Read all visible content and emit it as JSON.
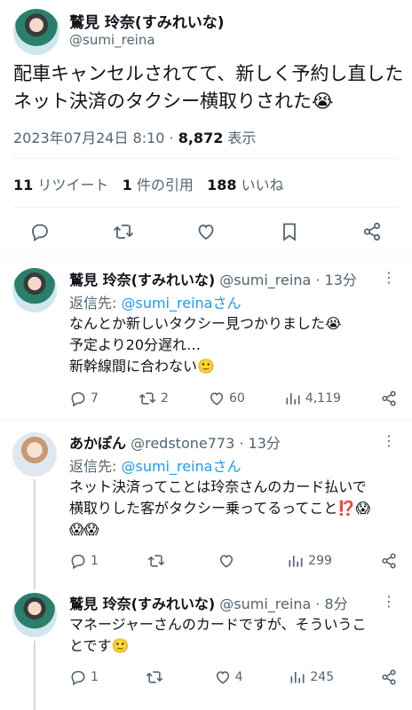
{
  "main_tweet": {
    "author_name": "鷲見 玲奈(すみれいな)",
    "handle": "@sumi_reina",
    "text_line1": "配車キャンセルされてて、新しく予約し直した",
    "text_line2": "ネット決済のタクシー横取りされた😭",
    "timestamp": "2023年07月24日 8:10 · ",
    "views_count": "8,872",
    "views_label": " 表示",
    "retweets_count": "11",
    "retweets_label": "リツイート",
    "quotes_count": "1",
    "quotes_label": "件の引用",
    "likes_count": "188",
    "likes_label": "いいね"
  },
  "replies": [
    {
      "author_name": "鷲見 玲奈(すみれいな)",
      "handle_time": "@sumi_reina · 13分",
      "reply_to_prefix": "返信先: ",
      "reply_to_handle": "@sumi_reinaさん",
      "lines": [
        "なんとか新しいタクシー見つかりました😭",
        "予定より20分遅れ…",
        "新幹線間に合わない🙂"
      ],
      "replies": "7",
      "retweets": "2",
      "likes": "60",
      "views": "4,119"
    },
    {
      "author_name": "あかぽん",
      "handle_time": "@redstone773 · 13分",
      "reply_to_prefix": "返信先: ",
      "reply_to_handle": "@sumi_reinaさん",
      "lines": [
        "ネット決済ってことは玲奈さんのカード払いで",
        "横取りした客がタクシー乗ってるってこと⁉️😱",
        "😱😱"
      ],
      "replies": "1",
      "retweets": "",
      "likes": "",
      "views": "299"
    },
    {
      "author_name": "鷲見 玲奈(すみれいな)",
      "handle_time": "@sumi_reina · 8分",
      "lines": [
        "マネージャーさんのカードですが、そういうこ",
        "とです🙂"
      ],
      "replies": "1",
      "retweets": "",
      "likes": "4",
      "views": "245"
    }
  ],
  "icons": {
    "reply": "reply-icon",
    "retweet": "retweet-icon",
    "like": "heart-icon",
    "bookmark": "bookmark-icon",
    "share": "share-icon",
    "views": "views-bar-icon",
    "more": "more-dots-icon"
  },
  "colors": {
    "link": "#1d9bf0",
    "muted": "#536471",
    "text": "#0f1419"
  }
}
